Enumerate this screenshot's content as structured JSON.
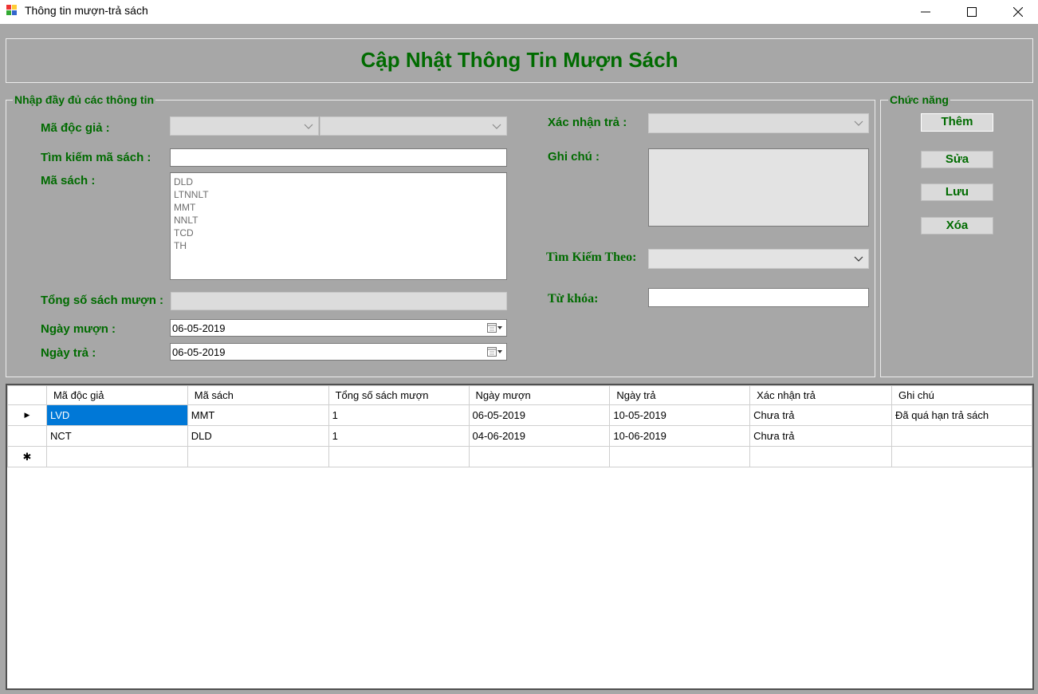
{
  "window": {
    "title": "Thông tin mượn-trả sách",
    "min_glyph": "—",
    "max_glyph": "☐",
    "close_glyph": "✕"
  },
  "header": {
    "title": "Cập Nhật Thông Tin Mượn Sách"
  },
  "input_group": {
    "title": "Nhập đầy đủ các thông tin",
    "reader_label": "Mã độc giả :",
    "search_label": "Tìm kiếm mã sách :",
    "search_value": "",
    "book_label": "Mã sách :",
    "book_list": [
      "DLD",
      "LTNNLT",
      "MMT",
      "NNLT",
      "TCD",
      "TH"
    ],
    "total_label": "Tổng số sách mượn :",
    "borrow_date_label": "Ngày mượn :",
    "borrow_date": "06-05-2019",
    "return_date_label": "Ngày trả :",
    "return_date": "06-05-2019",
    "confirm_label": "Xác nhận trả :",
    "note_label": "Ghi chú :",
    "search_by_label": "Tìm Kiếm Theo:",
    "keyword_label": "Từ khóa:"
  },
  "functions": {
    "title": "Chức năng",
    "add": "Thêm",
    "edit": "Sửa",
    "save": "Lưu",
    "delete": "Xóa"
  },
  "grid": {
    "columns": [
      "Mã độc giả",
      "Mã sách",
      "Tổng số sách mượn",
      "Ngày mượn",
      "Ngày trả",
      "Xác nhận trả",
      "Ghi chú"
    ],
    "rows": [
      [
        "LVD",
        "MMT",
        "1",
        "06-05-2019",
        "10-05-2019",
        "Chưa trả",
        "Đã quá hạn trả sách"
      ],
      [
        "NCT",
        "DLD",
        "1",
        "04-06-2019",
        "10-06-2019",
        "Chưa trả",
        ""
      ]
    ],
    "current_row_marker": "▶",
    "new_row_marker": "✱"
  },
  "colors": {
    "accent_green": "#006b00",
    "form_bg": "#a7a7a7",
    "selection": "#0078d7"
  }
}
